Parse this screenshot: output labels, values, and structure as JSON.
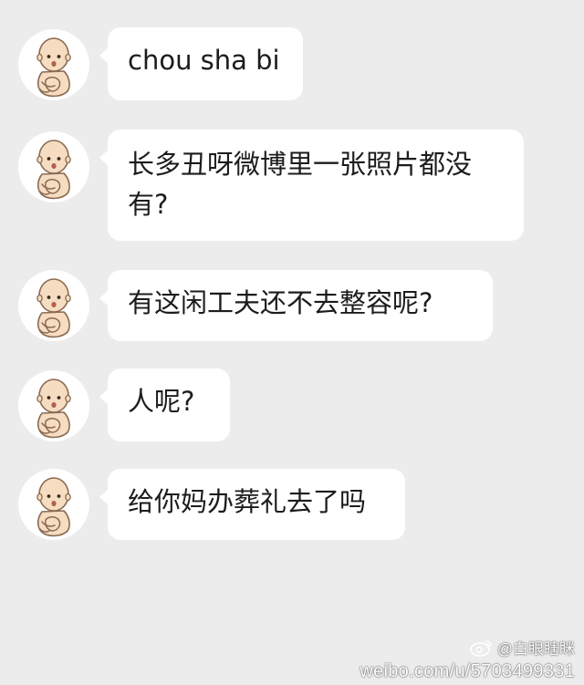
{
  "conversation": {
    "messages": [
      {
        "text": "chou sha bi"
      },
      {
        "text": "长多丑呀微博里一张照片都没有?"
      },
      {
        "text": "有这闲工夫还不去整容呢?"
      },
      {
        "text": "人呢?"
      },
      {
        "text": "给你妈办葬礼去了吗"
      }
    ]
  },
  "watermark": {
    "handle": "@白眼瞎眯",
    "url": "weibo.com/u/5703499331"
  },
  "colors": {
    "background": "#ececec",
    "bubble": "#ffffff",
    "text": "#1c1c1c",
    "avatar_skin": "#f6dcc0",
    "avatar_outline": "#8a6a52"
  },
  "icons": {
    "avatar": "baby-cartoon-icon",
    "watermark_logo": "weibo-logo-icon"
  }
}
